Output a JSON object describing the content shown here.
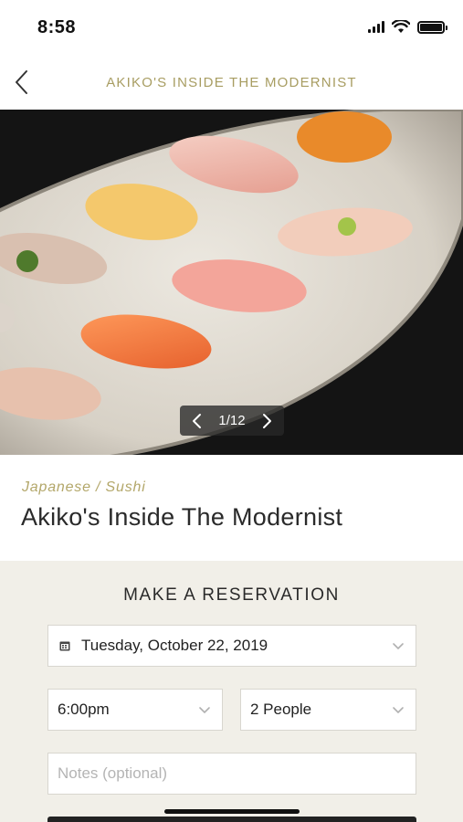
{
  "status_bar": {
    "time": "8:58"
  },
  "nav": {
    "title": "AKIKO'S INSIDE THE MODERNIST"
  },
  "gallery": {
    "pager_text": "1/12"
  },
  "restaurant": {
    "cuisine": "Japanese / Sushi",
    "name": "Akiko's Inside The Modernist"
  },
  "reservation": {
    "heading": "MAKE A RESERVATION",
    "date_value": "Tuesday, October 22, 2019",
    "time_value": "6:00pm",
    "party_value": "2 People",
    "notes_placeholder": "Notes (optional)"
  },
  "colors": {
    "accent": "#a89d62",
    "panel": "#f1efe8"
  },
  "icons": [
    "back-chevron-icon",
    "signal-icon",
    "wifi-icon",
    "battery-icon",
    "calendar-icon",
    "chevron-down-icon",
    "chevron-left-icon",
    "chevron-right-icon"
  ]
}
